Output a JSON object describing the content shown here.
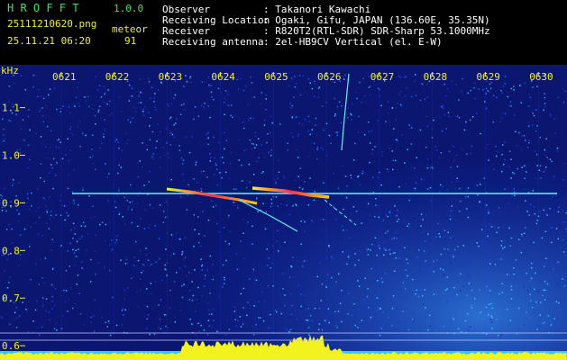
{
  "header": {
    "app_name": "H R O F F T",
    "version": "1.0.0",
    "filename": "25111210620.png",
    "datetime": "25.11.21 06:20",
    "meteor_label": "meteor",
    "meteor_count": "91",
    "fields": [
      {
        "label": "Observer",
        "value": ": Takanori Kawachi"
      },
      {
        "label": "Receiving Location",
        "value": ": Ogaki, Gifu, JAPAN (136.60E, 35.35N)"
      },
      {
        "label": "Receiver",
        "value": ": R820T2(RTL-SDR) SDR-Sharp 53.1000MHz"
      },
      {
        "label": "Receiving antenna",
        "value": ": 2el-HB9CV Vertical (el. E-W)"
      }
    ]
  },
  "chart_data": {
    "type": "heatmap",
    "ylabel": "kHz",
    "y_ticks": [
      "1.1",
      "1.0",
      "0.9",
      "0.8",
      "0.7",
      "0.6"
    ],
    "x_ticks": [
      "0621",
      "0622",
      "0623",
      "0624",
      "0625",
      "0626",
      "0627",
      "0628",
      "0629",
      "0630"
    ],
    "ylim": [
      0.57,
      1.19
    ],
    "colors": {
      "background": "#0a1670",
      "axis": "#f2f21e",
      "grid": "#2a3cff",
      "carrier": "#6af0f0",
      "level": "#f2f21e",
      "baseline": "#30c8ff"
    }
  }
}
